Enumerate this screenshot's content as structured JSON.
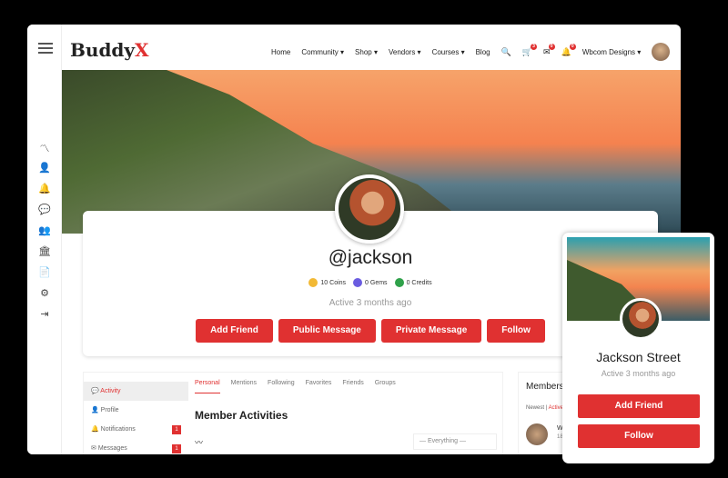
{
  "logo": {
    "main": "Buddy",
    "accent": "X"
  },
  "nav": {
    "items": [
      "Home",
      "Community ▾",
      "Shop ▾",
      "Vendors ▾",
      "Courses ▾",
      "Blog"
    ],
    "cart_badge": "3",
    "messages_badge": "0",
    "notifications_badge": "0",
    "user": "Wbcom Designs ▾"
  },
  "profile": {
    "username": "@jackson",
    "coins": "10 Coins",
    "gems": "0 Gems",
    "credits": "0 Credits",
    "active": "Active 3 months ago",
    "buttons": [
      "Add Friend",
      "Public Message",
      "Private Message",
      "Follow"
    ]
  },
  "menu": [
    {
      "label": "Activity"
    },
    {
      "label": "Profile"
    },
    {
      "label": "Notifications",
      "badge": "1"
    },
    {
      "label": "Messages",
      "badge": "1"
    }
  ],
  "tabs": [
    "Personal",
    "Mentions",
    "Following",
    "Favorites",
    "Friends",
    "Groups"
  ],
  "activity": {
    "title": "Member Activities",
    "filter": "— Everything —"
  },
  "members": {
    "title": "Members",
    "newest": "Newest",
    "active": "Active",
    "first_initial": "W",
    "first_meta": "18"
  },
  "mobile": {
    "name": "Jackson Street",
    "active": "Active 3 months ago",
    "add_friend": "Add Friend",
    "follow": "Follow"
  },
  "colors": {
    "accent": "#e03131"
  }
}
